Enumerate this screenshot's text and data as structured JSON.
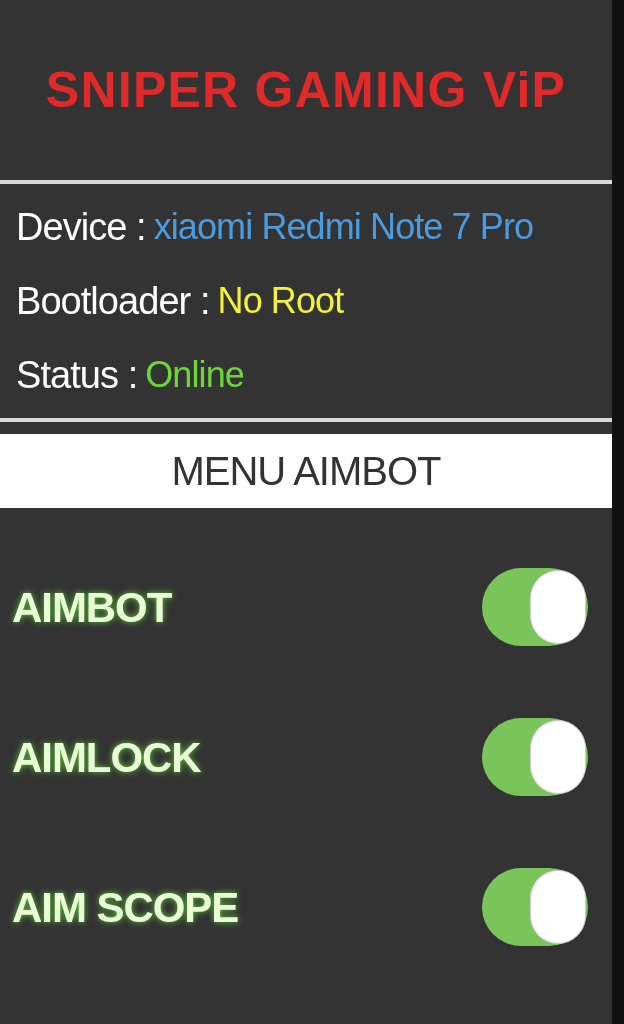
{
  "title": "SNIPER GAMING ViP",
  "info": [
    {
      "label": "Device :",
      "value": "xiaomi Redmi Note 7 Pro",
      "color": "#4a9be0"
    },
    {
      "label": "Bootloader :",
      "value": "No Root",
      "color": "#f2f23a"
    },
    {
      "label": "Status :",
      "value": "Online",
      "color": "#6fd63a"
    }
  ],
  "menu_header": "MENU AIMBOT",
  "toggles": [
    {
      "label": "AIMBOT",
      "on": true
    },
    {
      "label": "AIMLOCK",
      "on": true
    },
    {
      "label": "AIM SCOPE",
      "on": true
    }
  ]
}
